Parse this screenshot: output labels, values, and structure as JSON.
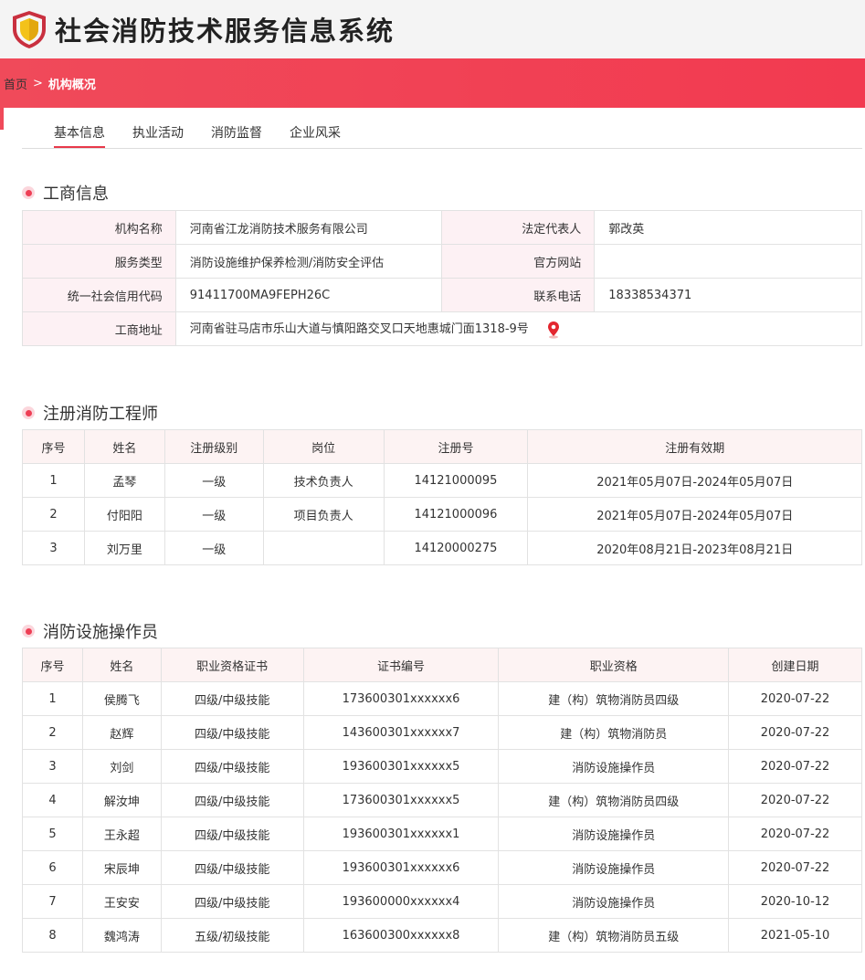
{
  "header": {
    "title": "社会消防技术服务信息系统"
  },
  "breadcrumb": {
    "home": "首页",
    "separator": ">",
    "current": "机构概况"
  },
  "tabs": [
    {
      "label": "基本信息",
      "active": true
    },
    {
      "label": "执业活动",
      "active": false
    },
    {
      "label": "消防监督",
      "active": false
    },
    {
      "label": "企业风采",
      "active": false
    }
  ],
  "business": {
    "title": "工商信息",
    "org_name_label": "机构名称",
    "org_name": "河南省江龙消防技术服务有限公司",
    "legal_rep_label": "法定代表人",
    "legal_rep": "郭改英",
    "service_type_label": "服务类型",
    "service_type": "消防设施维护保养检测/消防安全评估",
    "website_label": "官方网站",
    "website": "",
    "credit_code_label": "统一社会信用代码",
    "credit_code": "91411700MA9FEPH26C",
    "phone_label": "联系电话",
    "phone": "18338534371",
    "address_label": "工商地址",
    "address": "河南省驻马店市乐山大道与慎阳路交叉口天地惠城门面1318-9号"
  },
  "engineers": {
    "title": "注册消防工程师",
    "columns": [
      "序号",
      "姓名",
      "注册级别",
      "岗位",
      "注册号",
      "注册有效期"
    ],
    "rows": [
      [
        "1",
        "孟琴",
        "一级",
        "技术负责人",
        "14121000095",
        "2021年05月07日-2024年05月07日"
      ],
      [
        "2",
        "付阳阳",
        "一级",
        "项目负责人",
        "14121000096",
        "2021年05月07日-2024年05月07日"
      ],
      [
        "3",
        "刘万里",
        "一级",
        "",
        "14120000275",
        "2020年08月21日-2023年08月21日"
      ]
    ]
  },
  "operators": {
    "title": "消防设施操作员",
    "columns": [
      "序号",
      "姓名",
      "职业资格证书",
      "证书编号",
      "职业资格",
      "创建日期"
    ],
    "rows": [
      [
        "1",
        "侯腾飞",
        "四级/中级技能",
        "173600301xxxxxx6",
        "建（构）筑物消防员四级",
        "2020-07-22"
      ],
      [
        "2",
        "赵辉",
        "四级/中级技能",
        "143600301xxxxxx7",
        "建（构）筑物消防员",
        "2020-07-22"
      ],
      [
        "3",
        "刘剑",
        "四级/中级技能",
        "193600301xxxxxx5",
        "消防设施操作员",
        "2020-07-22"
      ],
      [
        "4",
        "解汝坤",
        "四级/中级技能",
        "173600301xxxxxx5",
        "建（构）筑物消防员四级",
        "2020-07-22"
      ],
      [
        "5",
        "王永超",
        "四级/中级技能",
        "193600301xxxxxx1",
        "消防设施操作员",
        "2020-07-22"
      ],
      [
        "6",
        "宋辰坤",
        "四级/中级技能",
        "193600301xxxxxx6",
        "消防设施操作员",
        "2020-07-22"
      ],
      [
        "7",
        "王安安",
        "四级/中级技能",
        "193600000xxxxxx4",
        "消防设施操作员",
        "2020-10-12"
      ],
      [
        "8",
        "魏鸿涛",
        "五级/初级技能",
        "163600300xxxxxx8",
        "建（构）筑物消防员五级",
        "2021-05-10"
      ]
    ]
  },
  "colors": {
    "accent": "#f04a5a",
    "label_bg": "#fdf1f4",
    "header_bg": "#fdf3f3"
  },
  "icons": {
    "logo": "shield-logo-icon",
    "address": "map-pin-icon",
    "section": "dot-bullet-icon"
  }
}
